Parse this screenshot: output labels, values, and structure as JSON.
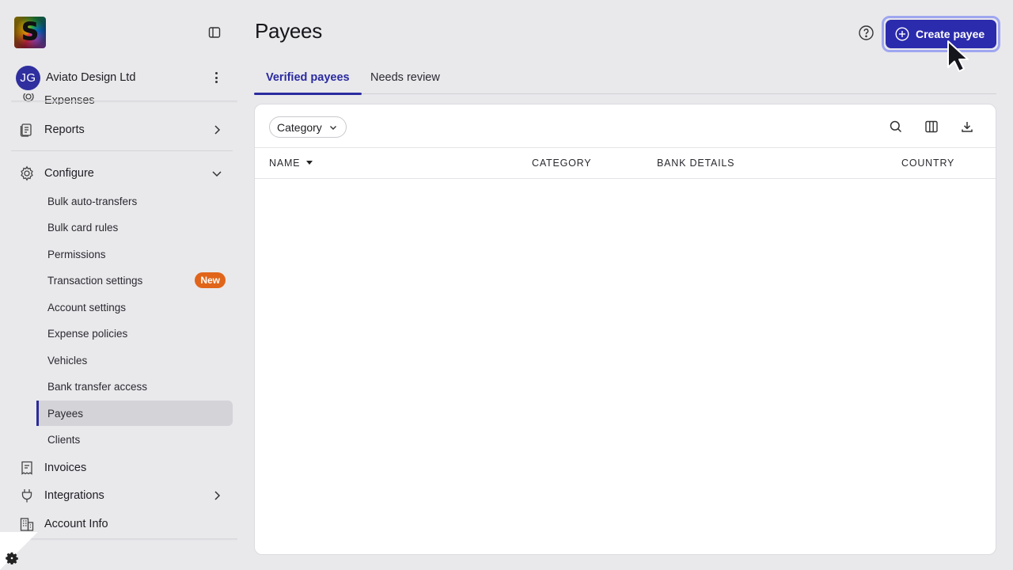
{
  "brand": {
    "logo_letter": "S"
  },
  "org": {
    "initials": "JG",
    "name": "Aviato Design Ltd"
  },
  "sidebar": {
    "partial_item": "Expenses",
    "reports": "Reports",
    "configure": "Configure",
    "sub_items": [
      "Bulk auto-transfers",
      "Bulk card rules",
      "Permissions",
      "Transaction settings",
      "Account settings",
      "Expense policies",
      "Vehicles",
      "Bank transfer access",
      "Payees",
      "Clients"
    ],
    "new_badge": "New",
    "invoices": "Invoices",
    "integrations": "Integrations",
    "account_info": "Account Info"
  },
  "header": {
    "title": "Payees",
    "create_label": "Create payee"
  },
  "tabs": [
    {
      "label": "Verified payees",
      "active": true
    },
    {
      "label": "Needs review",
      "active": false
    }
  ],
  "filters": {
    "category_label": "Category"
  },
  "table": {
    "columns": [
      "NAME",
      "CATEGORY",
      "BANK DETAILS",
      "COUNTRY"
    ],
    "rows": []
  },
  "colors": {
    "accent": "#2b2bad",
    "badge": "#e0651a",
    "background": "#e9e9ec"
  }
}
